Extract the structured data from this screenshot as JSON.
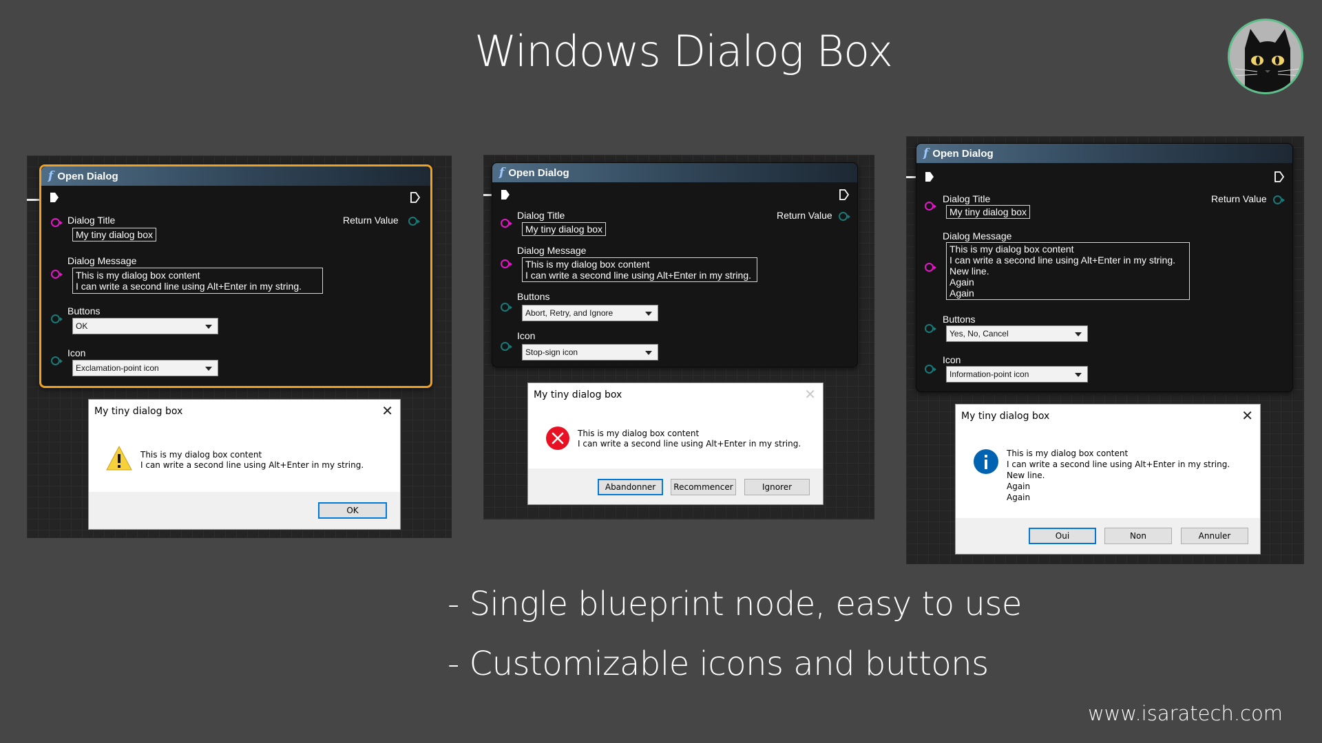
{
  "title": "Windows Dialog Box",
  "bullets": [
    "- Single blueprint node, easy to use",
    "- Customizable icons and buttons"
  ],
  "website": "www.isaratech.com",
  "colors": {
    "accent_orange": "#f0a11e",
    "pin_pink": "#e617c8",
    "pin_teal": "#1a7a78",
    "win_blue": "#0078d7"
  },
  "panels": [
    {
      "node": {
        "header": "Open Dialog",
        "labels": {
          "title": "Dialog Title",
          "message": "Dialog Message",
          "buttons": "Buttons",
          "icon": "Icon",
          "return": "Return Value"
        },
        "title_value": "My tiny dialog box",
        "message_value": "This is my dialog box content\nI can write a second line using Alt+Enter in my string.",
        "buttons_value": "OK",
        "icon_value": "Exclamation-point icon"
      },
      "dialog": {
        "title": "My tiny dialog box",
        "icon": "warning-icon",
        "message": "This is my dialog box content\nI can write a second line using Alt+Enter in my string.",
        "buttons": [
          "OK"
        ]
      }
    },
    {
      "node": {
        "header": "Open Dialog",
        "labels": {
          "title": "Dialog Title",
          "message": "Dialog Message",
          "buttons": "Buttons",
          "icon": "Icon",
          "return": "Return Value"
        },
        "title_value": "My tiny dialog box",
        "message_value": "This is my dialog box content\nI can write a second line using Alt+Enter in my string.",
        "buttons_value": "Abort, Retry, and Ignore",
        "icon_value": "Stop-sign icon"
      },
      "dialog": {
        "title": "My tiny dialog box",
        "icon": "error-icon",
        "message": "This is my dialog box content\nI can write a second line using Alt+Enter in my string.",
        "buttons": [
          "Abandonner",
          "Recommencer",
          "Ignorer"
        ]
      }
    },
    {
      "node": {
        "header": "Open Dialog",
        "labels": {
          "title": "Dialog Title",
          "message": "Dialog Message",
          "buttons": "Buttons",
          "icon": "Icon",
          "return": "Return Value"
        },
        "title_value": "My tiny dialog box",
        "message_value": "This is my dialog box content\nI can write a second line using Alt+Enter in my string.\nNew line.\nAgain\nAgain",
        "buttons_value": "Yes, No, Cancel",
        "icon_value": "Information-point icon"
      },
      "dialog": {
        "title": "My tiny dialog box",
        "icon": "info-icon",
        "message": "This is my dialog box content\nI can write a second line using Alt+Enter in my string.\nNew line.\nAgain\nAgain",
        "buttons": [
          "Oui",
          "Non",
          "Annuler"
        ]
      }
    }
  ]
}
